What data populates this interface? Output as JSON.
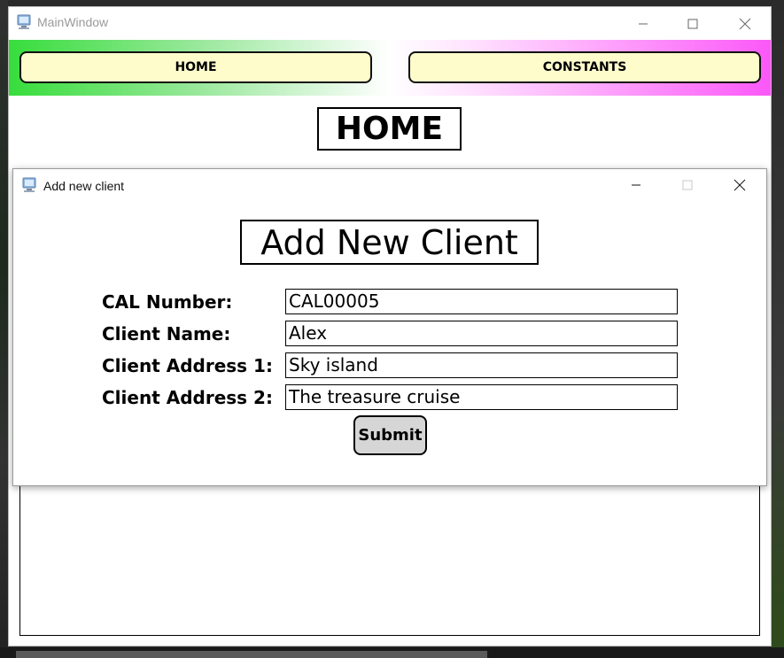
{
  "main_window": {
    "title": "MainWindow",
    "nav": {
      "home_label": "HOME",
      "constants_label": "CONSTANTS"
    },
    "page_title": "HOME"
  },
  "dialog": {
    "title": "Add new client",
    "heading": "Add New Client",
    "fields": [
      {
        "label": "CAL Number:",
        "value": "CAL00005"
      },
      {
        "label": "Client Name:",
        "value": "Alex"
      },
      {
        "label": "Client Address 1:",
        "value": "Sky island"
      },
      {
        "label": "Client Address 2:",
        "value": "The treasure cruise"
      }
    ],
    "submit_label": "Submit"
  },
  "colors": {
    "nav_gradient_left": "#37dd3c",
    "nav_gradient_right": "#fb58f8",
    "nav_button_bg": "#fffccc",
    "submit_bg": "#d6d6d6"
  }
}
